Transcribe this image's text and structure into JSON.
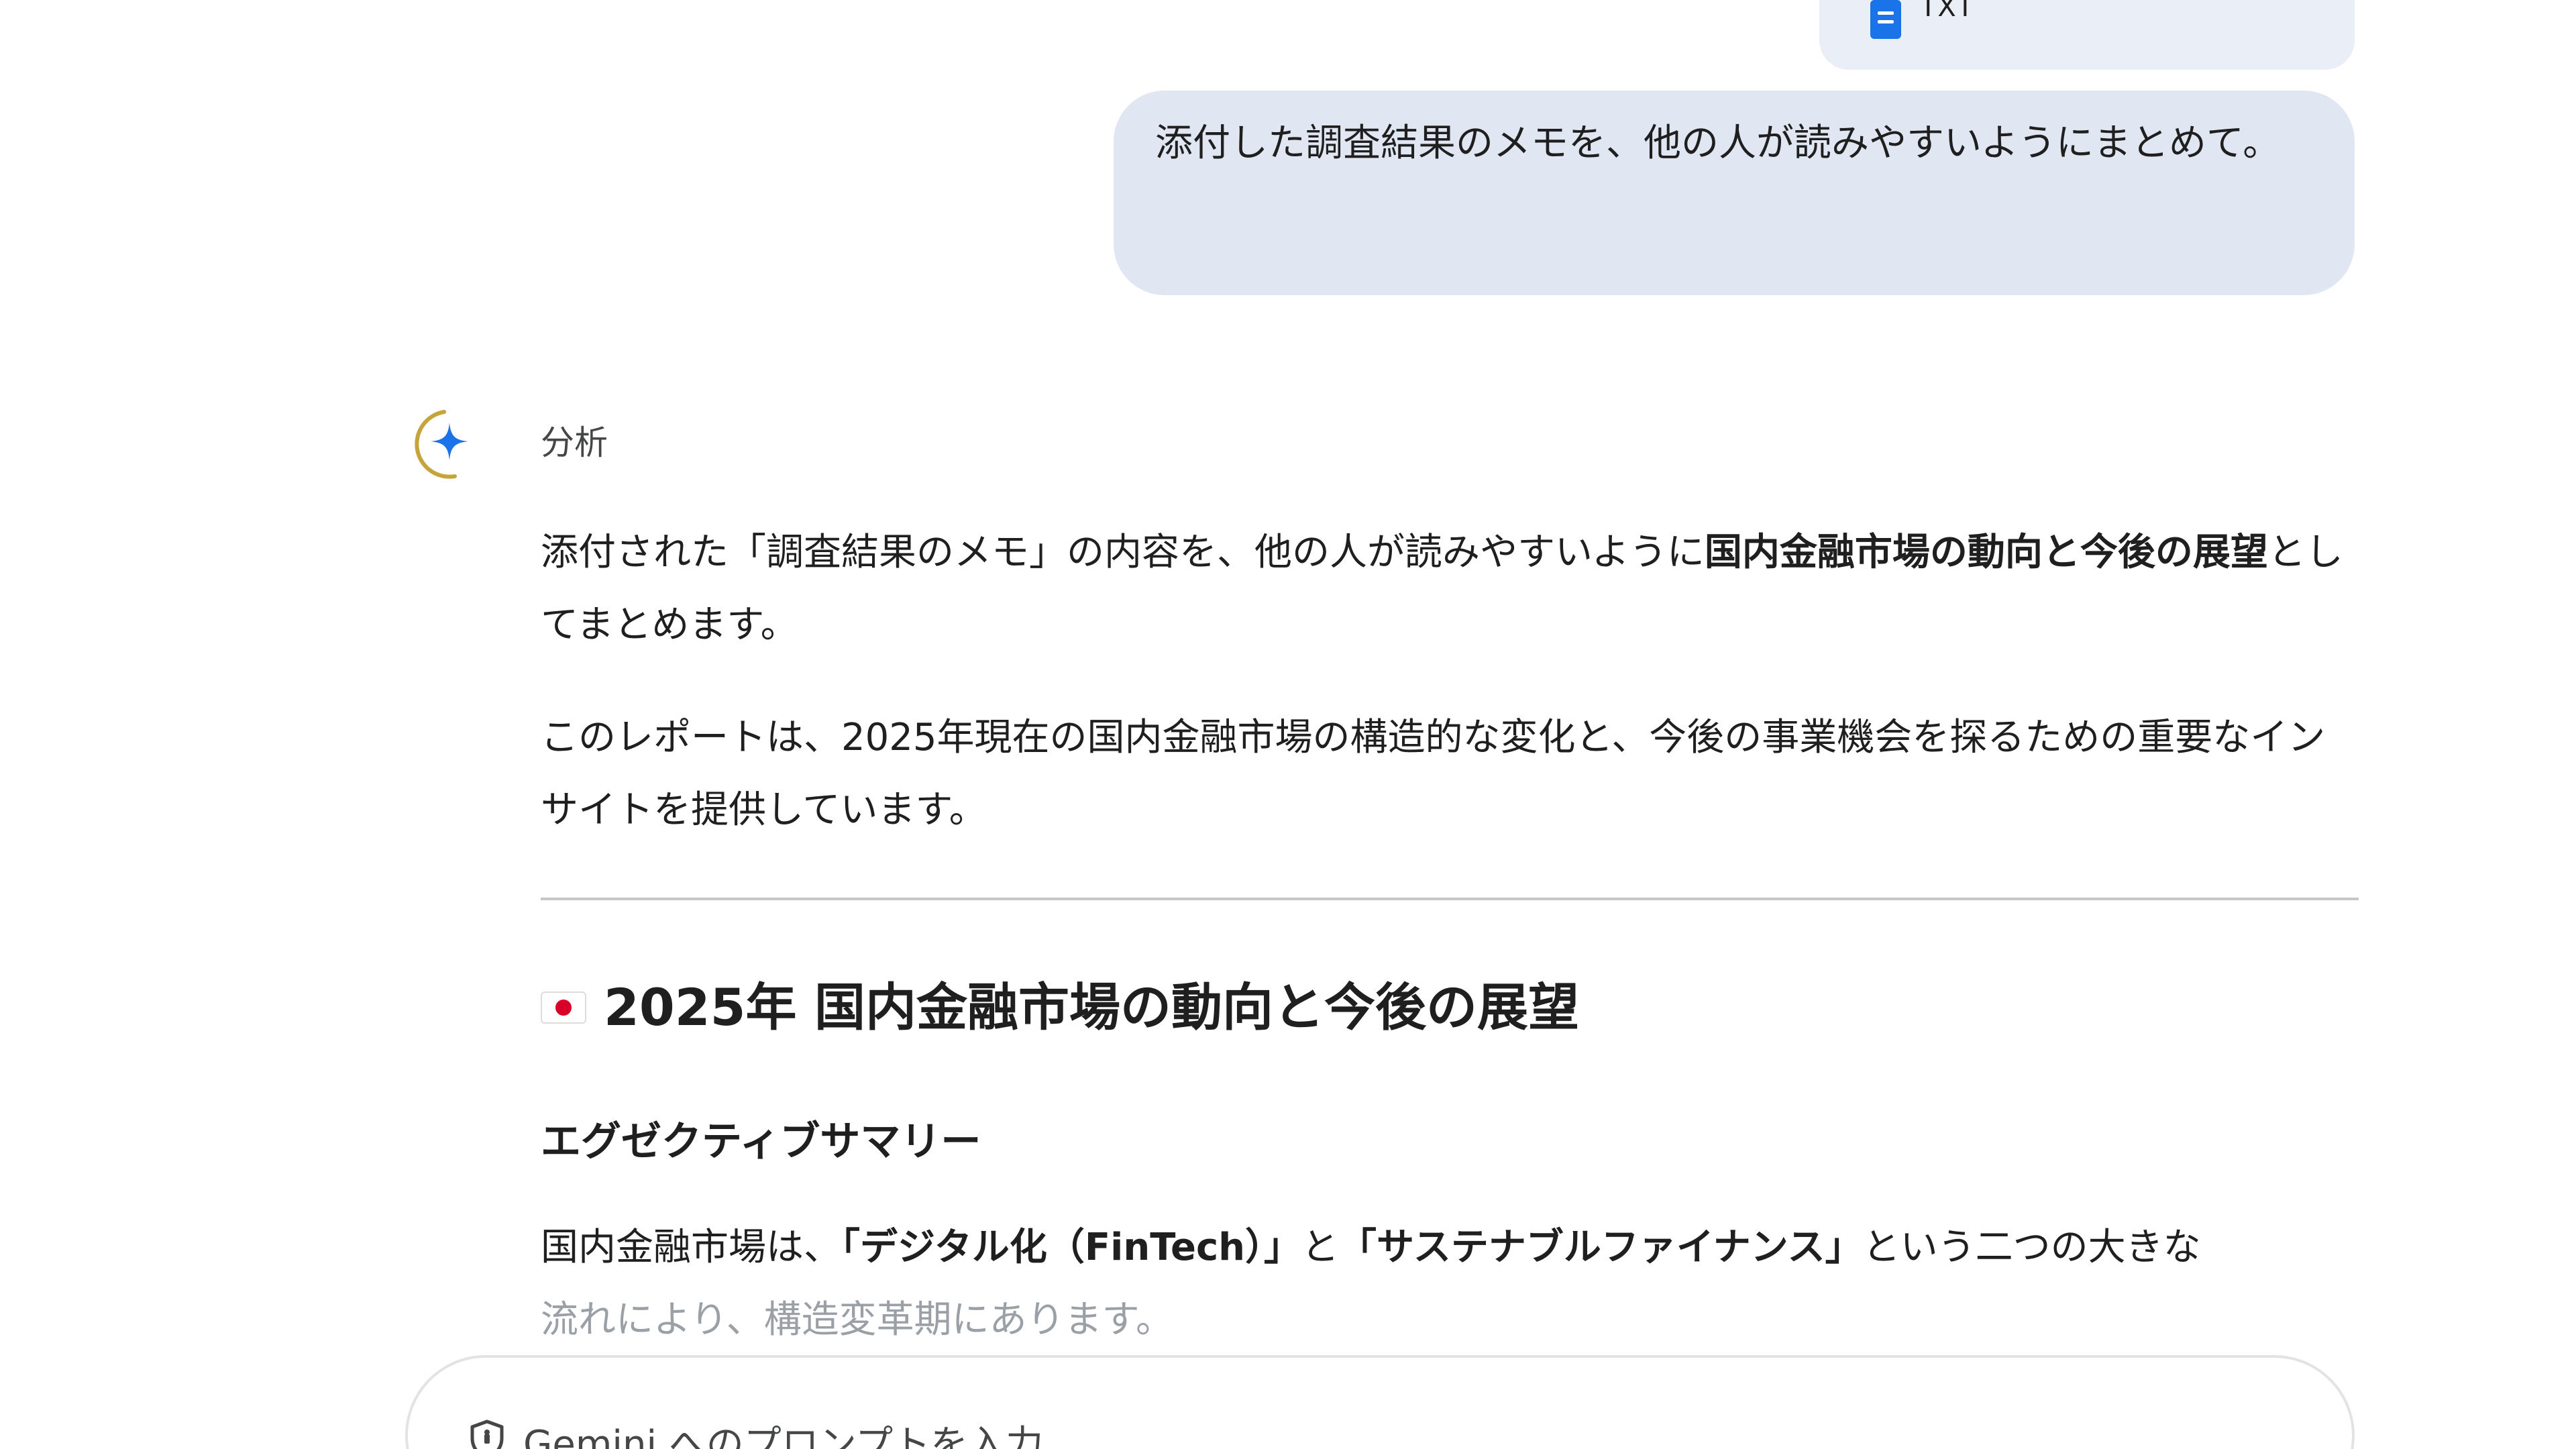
{
  "attachment": {
    "file_type": "TXT",
    "icon": "document-icon"
  },
  "user_message": {
    "text": "添付した調査結果のメモを、他の人が読みやすいようにまとめて。"
  },
  "model": {
    "avatar_icon": "gemini-sparkle-icon",
    "status_label": "分析"
  },
  "response": {
    "para1_prefix": "添付された「調査結果のメモ」の内容を、他の人が読みやすいように",
    "para1_bold": "国内金融市場の動向と今後の展望",
    "para1_suffix": "としてまとめます。",
    "para2": "このレポートは、2025年現在の国内金融市場の構造的な変化と、今後の事業機会を探るための重要なインサイトを提供しています。",
    "title_icon": "japan-flag-icon",
    "title": "2025年 国内金融市場の動向と今後の展望",
    "section_heading": "エグゼクティブサマリー",
    "para3_a": "国内金融市場は、",
    "para3_b_bold": "「デジタル化（FinTech）」",
    "para3_c": "と",
    "para3_d_bold": "「サステナブルファイナンス」",
    "para3_e": "という二つの大きな",
    "para3_faded": "流れにより、構造変革期にあります。"
  },
  "input": {
    "placeholder": "Gemini へのプロンプトを入力",
    "icon": "shield-icon"
  },
  "colors": {
    "user_bubble": "#e0e7f2",
    "attachment_chip": "#eaeef6",
    "accent_blue": "#1a73e8",
    "gemini_ring": "#c6a43a",
    "divider": "#c4c7c5"
  }
}
